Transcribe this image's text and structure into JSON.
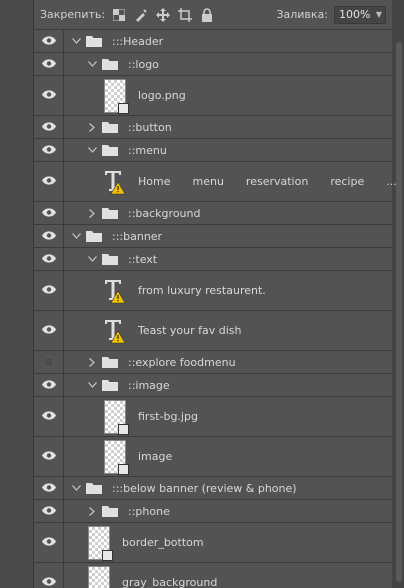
{
  "toolbar": {
    "lock_label": "Закрепить:",
    "fill_label": "Заливка:",
    "fill_value": "100%"
  },
  "layers": [
    {
      "kind": "group",
      "name": ":::Header",
      "indent": 0,
      "expanded": true,
      "visible": true
    },
    {
      "kind": "group",
      "name": "::logo",
      "indent": 1,
      "expanded": true,
      "visible": true
    },
    {
      "kind": "image",
      "name": "logo.png",
      "indent": 2,
      "visible": true
    },
    {
      "kind": "group",
      "name": "::button",
      "indent": 1,
      "expanded": false,
      "visible": true
    },
    {
      "kind": "group",
      "name": "::menu",
      "indent": 1,
      "expanded": true,
      "visible": true
    },
    {
      "kind": "text",
      "name": "",
      "words": [
        "Home",
        "menu",
        "reservation",
        "recipe",
        "..."
      ],
      "indent": 2,
      "visible": true
    },
    {
      "kind": "group",
      "name": "::background",
      "indent": 1,
      "expanded": false,
      "visible": true
    },
    {
      "kind": "group",
      "name": ":::banner",
      "indent": 0,
      "expanded": true,
      "visible": true
    },
    {
      "kind": "group",
      "name": "::text",
      "indent": 1,
      "expanded": true,
      "visible": true
    },
    {
      "kind": "text",
      "name": "from luxury restaurent.",
      "indent": 2,
      "visible": true
    },
    {
      "kind": "text",
      "name": "Teast your fav dish",
      "indent": 2,
      "visible": true
    },
    {
      "kind": "group",
      "name": "::explore foodmenu",
      "indent": 1,
      "expanded": false,
      "visible": false
    },
    {
      "kind": "group",
      "name": "::image",
      "indent": 1,
      "expanded": true,
      "visible": true
    },
    {
      "kind": "image",
      "name": "first-bg.jpg",
      "indent": 2,
      "visible": true
    },
    {
      "kind": "image",
      "name": "image",
      "indent": 2,
      "visible": true
    },
    {
      "kind": "group",
      "name": ":::below banner (review & phone)",
      "indent": 0,
      "expanded": true,
      "visible": true
    },
    {
      "kind": "group",
      "name": "::phone",
      "indent": 1,
      "expanded": false,
      "visible": true
    },
    {
      "kind": "image",
      "name": "border_bottom",
      "indent": 1,
      "visible": true
    },
    {
      "kind": "image",
      "name": "gray_background",
      "indent": 1,
      "visible": true
    }
  ]
}
